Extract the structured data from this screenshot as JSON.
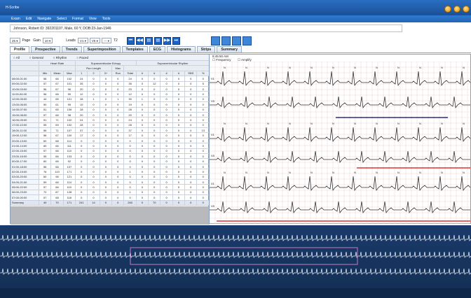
{
  "window": {
    "title": "H-Scribe"
  },
  "menu": [
    "Exam",
    "Edit",
    "Navigate",
    "Select",
    "Format",
    "View",
    "Tools"
  ],
  "patient": {
    "text": "Johnson, Robert ID: 392201107, Male, 60 Y, DOB:23-Jan-1946"
  },
  "toolbar": {
    "speed_value": "25 ▾",
    "page_label": "Page",
    "gain_label": "Gain",
    "gain_value": "10 ▾",
    "leads_label": "Leads",
    "lead1": "V1 ▾",
    "lead2": "V5 ▾",
    "lead3": "--- ▾",
    "count": "T2",
    "nav_buttons": [
      "⏮",
      "◀◀",
      "▤",
      "▤",
      "▶▶",
      "⏭"
    ]
  },
  "tabs": [
    "Profile",
    "Prospective",
    "Trends",
    "Superimposition",
    "Templates",
    "ECG",
    "Histograms",
    "Strips",
    "Summary"
  ],
  "filters": [
    "All",
    "General",
    "Rhythm",
    "Paced"
  ],
  "table": {
    "group_headers": [
      "Heart Rate",
      "Supraventricular Ectopy",
      "Supraventricular Rhythm"
    ],
    "sub_headers": [
      "Run Length",
      "Max"
    ],
    "columns": [
      "Min",
      "Mean",
      "Max",
      "1",
      "2",
      "3+",
      "Run",
      "Total",
      "#",
      "#",
      "#",
      "#",
      "SBS",
      "%"
    ],
    "rows": [
      [
        "08:00-01:00",
        "58",
        "66",
        "102",
        "24",
        "0",
        "0",
        "0",
        "24",
        "0",
        "0",
        "0",
        "0",
        "0",
        "0"
      ],
      [
        "09:00-02:00",
        "57",
        "67",
        "101",
        "35",
        "0",
        "0",
        "0",
        "35",
        "0",
        "12",
        "0",
        "0",
        "0",
        "5"
      ],
      [
        "10:00-03:00",
        "56",
        "67",
        "96",
        "20",
        "0",
        "0",
        "0",
        "20",
        "0",
        "0",
        "0",
        "0",
        "0",
        "0"
      ],
      [
        "11:00-04:00",
        "56",
        "66",
        "90",
        "12",
        "0",
        "0",
        "0",
        "12",
        "0",
        "0",
        "0",
        "0",
        "0",
        "0"
      ],
      [
        "12:00-05:00",
        "44",
        "65",
        "101",
        "28",
        "1",
        "0",
        "1",
        "30",
        "1",
        "0",
        "0",
        "0",
        "0",
        "0"
      ],
      [
        "13:00-06:00",
        "50",
        "61",
        "95",
        "19",
        "0",
        "0",
        "0",
        "19",
        "0",
        "0",
        "0",
        "0",
        "0",
        "0"
      ],
      [
        "14:00-07:00",
        "51",
        "65",
        "106",
        "28",
        "0",
        "0",
        "0",
        "28",
        "0",
        "0",
        "0",
        "0",
        "0",
        "0"
      ],
      [
        "15:00-08:00",
        "57",
        "66",
        "98",
        "20",
        "0",
        "0",
        "0",
        "20",
        "0",
        "0",
        "0",
        "0",
        "0",
        "0"
      ],
      [
        "16:00-09:00",
        "51",
        "71",
        "102",
        "24",
        "0",
        "0",
        "0",
        "24",
        "0",
        "0",
        "0",
        "0",
        "0",
        "0"
      ],
      [
        "17:00-10:00",
        "55",
        "69",
        "102",
        "28",
        "0",
        "0",
        "0",
        "28",
        "0",
        "0",
        "0",
        "0",
        "0",
        "0"
      ],
      [
        "18:00-11:00",
        "56",
        "71",
        "107",
        "37",
        "0",
        "0",
        "0",
        "37",
        "0",
        "0",
        "0",
        "0",
        "0",
        "13"
      ],
      [
        "19:00-12:00",
        "58",
        "67",
        "100",
        "17",
        "0",
        "0",
        "0",
        "17",
        "0",
        "0",
        "0",
        "0",
        "0",
        "0"
      ],
      [
        "20:00-13:00",
        "60",
        "68",
        "114",
        "0",
        "0",
        "0",
        "0",
        "0",
        "0",
        "0",
        "0",
        "0",
        "0",
        "0"
      ],
      [
        "21:00-14:00",
        "60",
        "66",
        "111",
        "0",
        "0",
        "0",
        "0",
        "0",
        "0",
        "0",
        "0",
        "0",
        "0",
        "0"
      ],
      [
        "22:00-15:00",
        "57",
        "66",
        "110",
        "0",
        "0",
        "0",
        "0",
        "0",
        "0",
        "0",
        "0",
        "0",
        "0",
        "0"
      ],
      [
        "23:00-16:00",
        "55",
        "66",
        "103",
        "0",
        "0",
        "0",
        "0",
        "0",
        "0",
        "0",
        "0",
        "0",
        "0",
        "0"
      ],
      [
        "00:00-17:00",
        "60",
        "66",
        "92",
        "0",
        "0",
        "0",
        "0",
        "0",
        "0",
        "0",
        "0",
        "0",
        "0",
        "0"
      ],
      [
        "01:00-18:00",
        "56",
        "68",
        "107",
        "0",
        "0",
        "0",
        "0",
        "0",
        "0",
        "0",
        "0",
        "0",
        "0",
        "0"
      ],
      [
        "02:00-19:00",
        "76",
        "119",
        "171",
        "0",
        "0",
        "0",
        "0",
        "1",
        "0",
        "0",
        "0",
        "0",
        "0",
        "0"
      ],
      [
        "03:00-20:00",
        "60",
        "96",
        "121",
        "0",
        "0",
        "0",
        "0",
        "0",
        "0",
        "0",
        "0",
        "0",
        "0",
        "0"
      ],
      [
        "04:00-21:00",
        "59",
        "66",
        "114",
        "0",
        "0",
        "0",
        "0",
        "0",
        "0",
        "0",
        "0",
        "0",
        "0",
        "0"
      ],
      [
        "05:00-22:00",
        "57",
        "66",
        "110",
        "0",
        "0",
        "0",
        "0",
        "0",
        "0",
        "0",
        "0",
        "0",
        "0",
        "0"
      ],
      [
        "06:00-23:00",
        "72",
        "87",
        "128",
        "0",
        "0",
        "0",
        "0",
        "1",
        "0",
        "0",
        "0",
        "0",
        "0",
        "0"
      ],
      [
        "07:00-00:00",
        "57",
        "68",
        "118",
        "0",
        "0",
        "0",
        "0",
        "0",
        "0",
        "0",
        "0",
        "0",
        "0",
        "0"
      ],
      [
        "Summary",
        "40",
        "70",
        "171",
        "241",
        "14",
        "0",
        "0",
        "263",
        "0",
        "70",
        "0",
        "0",
        "0",
        "0"
      ]
    ]
  },
  "ecg": {
    "time_label": "8:45:50 AM",
    "options": [
      "Frequency",
      "Amplify"
    ],
    "lead_labels": [
      "V1",
      "V5"
    ]
  }
}
